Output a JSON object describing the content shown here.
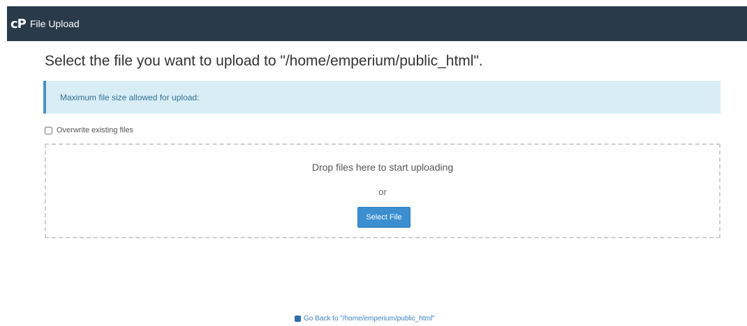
{
  "header": {
    "logo_text": "cP",
    "title": "File Upload"
  },
  "main": {
    "heading": "Select the file you want to upload to \"/home/emperium/public_html\".",
    "info_message": "Maximum file size allowed for upload:",
    "overwrite_label": "Overwrite existing files",
    "overwrite_checked": false,
    "dropzone": {
      "drop_text": "Drop files here to start uploading",
      "or_text": "or",
      "select_button_label": "Select File"
    }
  },
  "footer": {
    "back_link_text": "Go Back to \"/home/emperium/public_html\""
  },
  "colors": {
    "header_bg": "#293a4a",
    "alert_bg": "#d9edf7",
    "button_bg": "#3b8ed0"
  }
}
